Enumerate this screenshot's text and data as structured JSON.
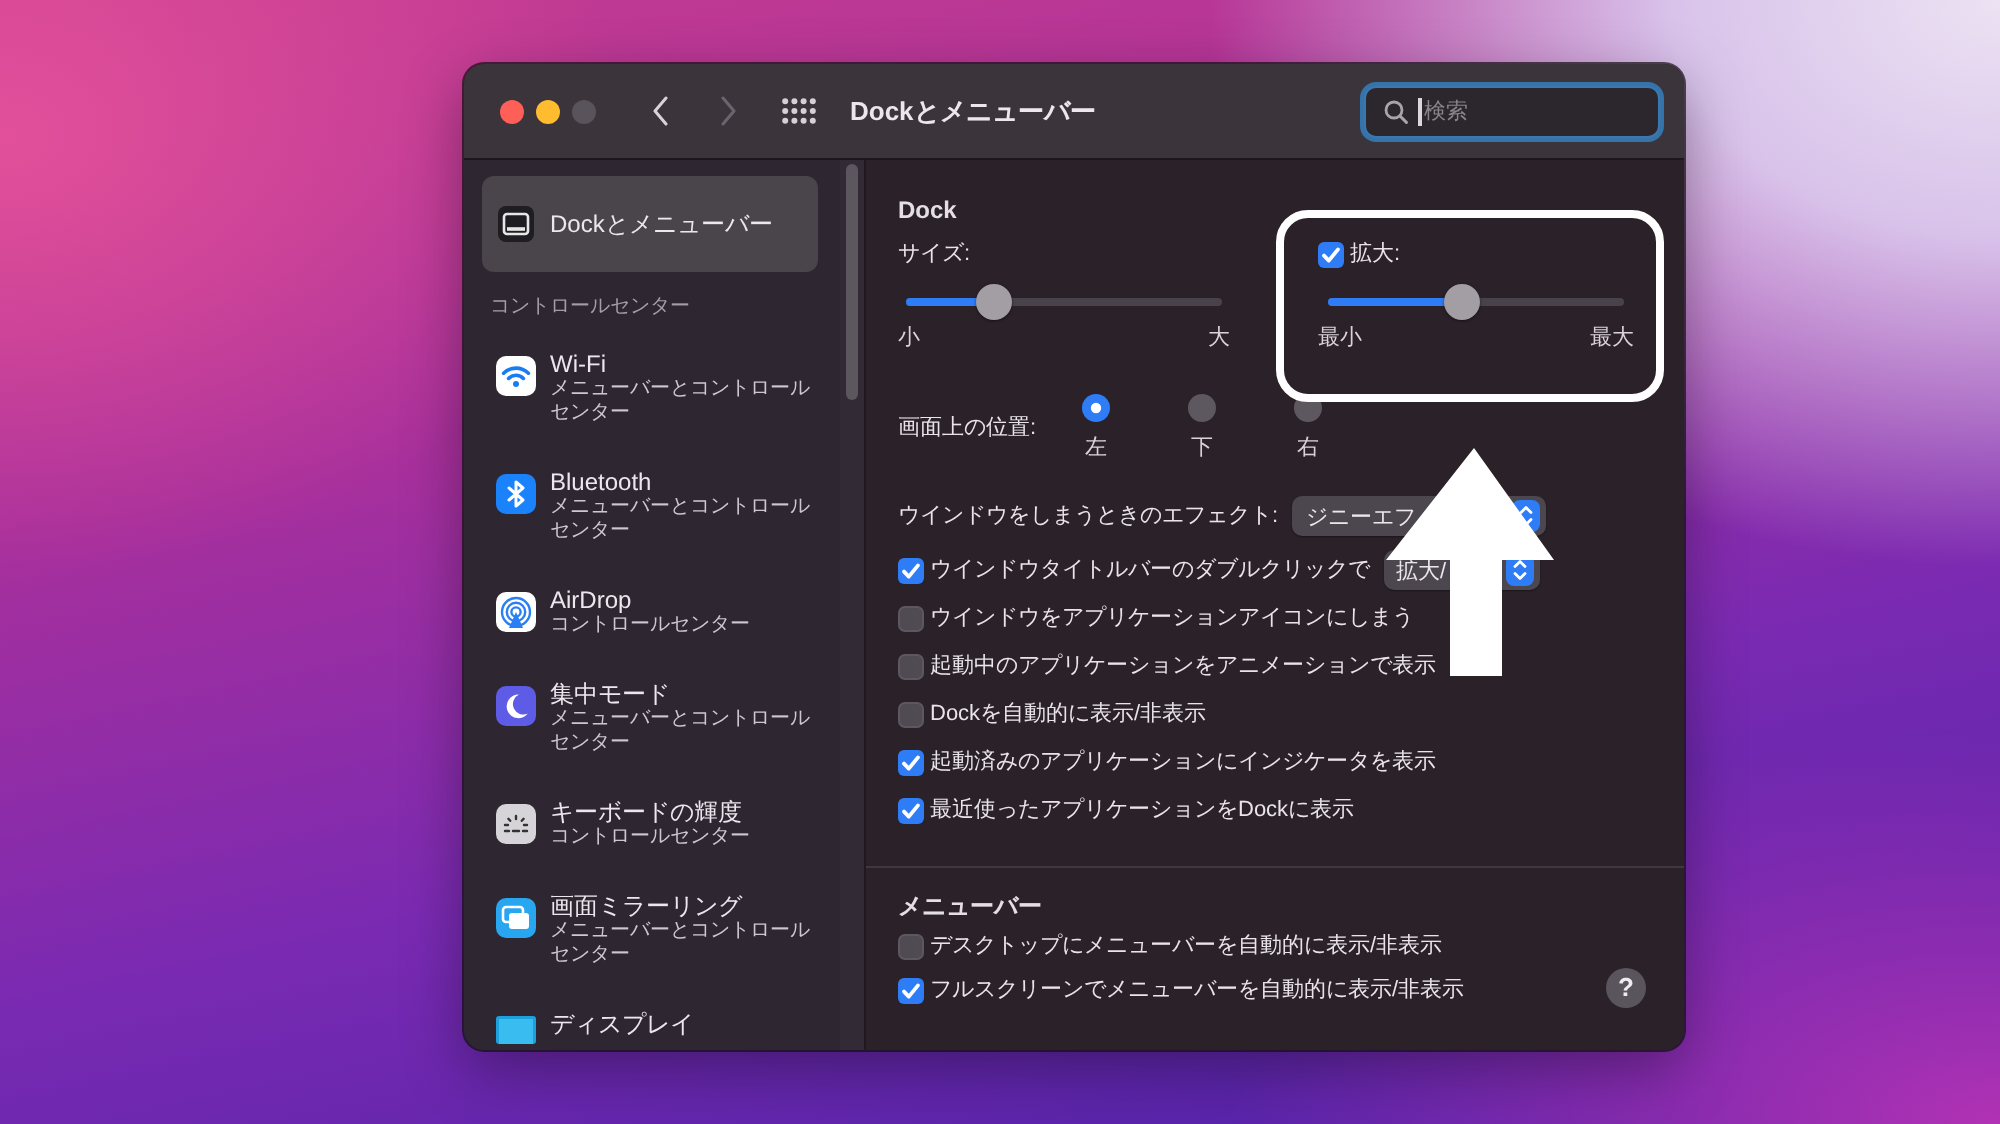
{
  "window": {
    "title": "Dockとメニューバー",
    "controls": [
      {
        "kind": "close",
        "disabled": false
      },
      {
        "kind": "minimize",
        "disabled": false
      },
      {
        "kind": "zoom",
        "disabled": true
      }
    ],
    "navigation": [
      {
        "kind": "back",
        "disabled": false
      },
      {
        "kind": "forward",
        "disabled": true
      }
    ]
  },
  "search": {
    "placeholder": "検索",
    "focused": true
  },
  "sidebar": {
    "items": [
      {
        "title": "Dockとメニューバー",
        "selected": true
      }
    ],
    "sections": [
      {
        "header": "コントロールセンター",
        "items": [
          {
            "title": "Wi-Fi",
            "subtitle": "メニューバーとコントロールセンター",
            "selected": false
          },
          {
            "title": "Bluetooth",
            "subtitle": "メニューバーとコントロールセンター",
            "selected": false
          },
          {
            "title": "AirDrop",
            "subtitle": "コントロールセンター",
            "selected": false
          },
          {
            "title": "集中モード",
            "subtitle": "メニューバーとコントロールセンター",
            "selected": false
          },
          {
            "title": "キーボードの輝度",
            "subtitle": "コントロールセンター",
            "selected": false
          },
          {
            "title": "画面ミラーリング",
            "subtitle": "メニューバーとコントロールセンター",
            "selected": false
          },
          {
            "title": "ディスプレイ",
            "selected": false
          }
        ]
      }
    ]
  },
  "dock": {
    "heading": "Dock",
    "size": {
      "label": "サイズ:",
      "level": 0.28,
      "min_label": "小",
      "max_label": "大"
    },
    "magnification": {
      "label": "拡大:",
      "checked": true,
      "level": 0.45,
      "min_label": "最小",
      "max_label": "最大"
    },
    "position": {
      "label": "画面上の位置:",
      "options": [
        {
          "label": "左",
          "selected": true
        },
        {
          "label": "下",
          "selected": false
        },
        {
          "label": "右",
          "selected": false
        }
      ]
    },
    "minimize_effect": {
      "label": "ウインドウをしまうときのエフェクト:",
      "value": "ジニーエフ"
    },
    "options": [
      {
        "label": "ウインドウタイトルバーのダブルクリックで",
        "checked": true,
        "value": "拡大/"
      },
      {
        "label": "ウインドウをアプリケーションアイコンにしまう",
        "checked": false
      },
      {
        "label": "起動中のアプリケーションをアニメーションで表示",
        "checked": false
      },
      {
        "label": "Dockを自動的に表示/非表示",
        "checked": false
      },
      {
        "label": "起動済みのアプリケーションにインジケータを表示",
        "checked": true
      },
      {
        "label": "最近使ったアプリケーションをDockに表示",
        "checked": true
      }
    ]
  },
  "menu_bar": {
    "heading": "メニューバー",
    "options": [
      {
        "label": "デスクトップにメニューバーを自動的に表示/非表示",
        "checked": false
      },
      {
        "label": "フルスクリーンでメニューバーを自動的に表示/非表示",
        "checked": true
      }
    ]
  },
  "help_button": "?"
}
